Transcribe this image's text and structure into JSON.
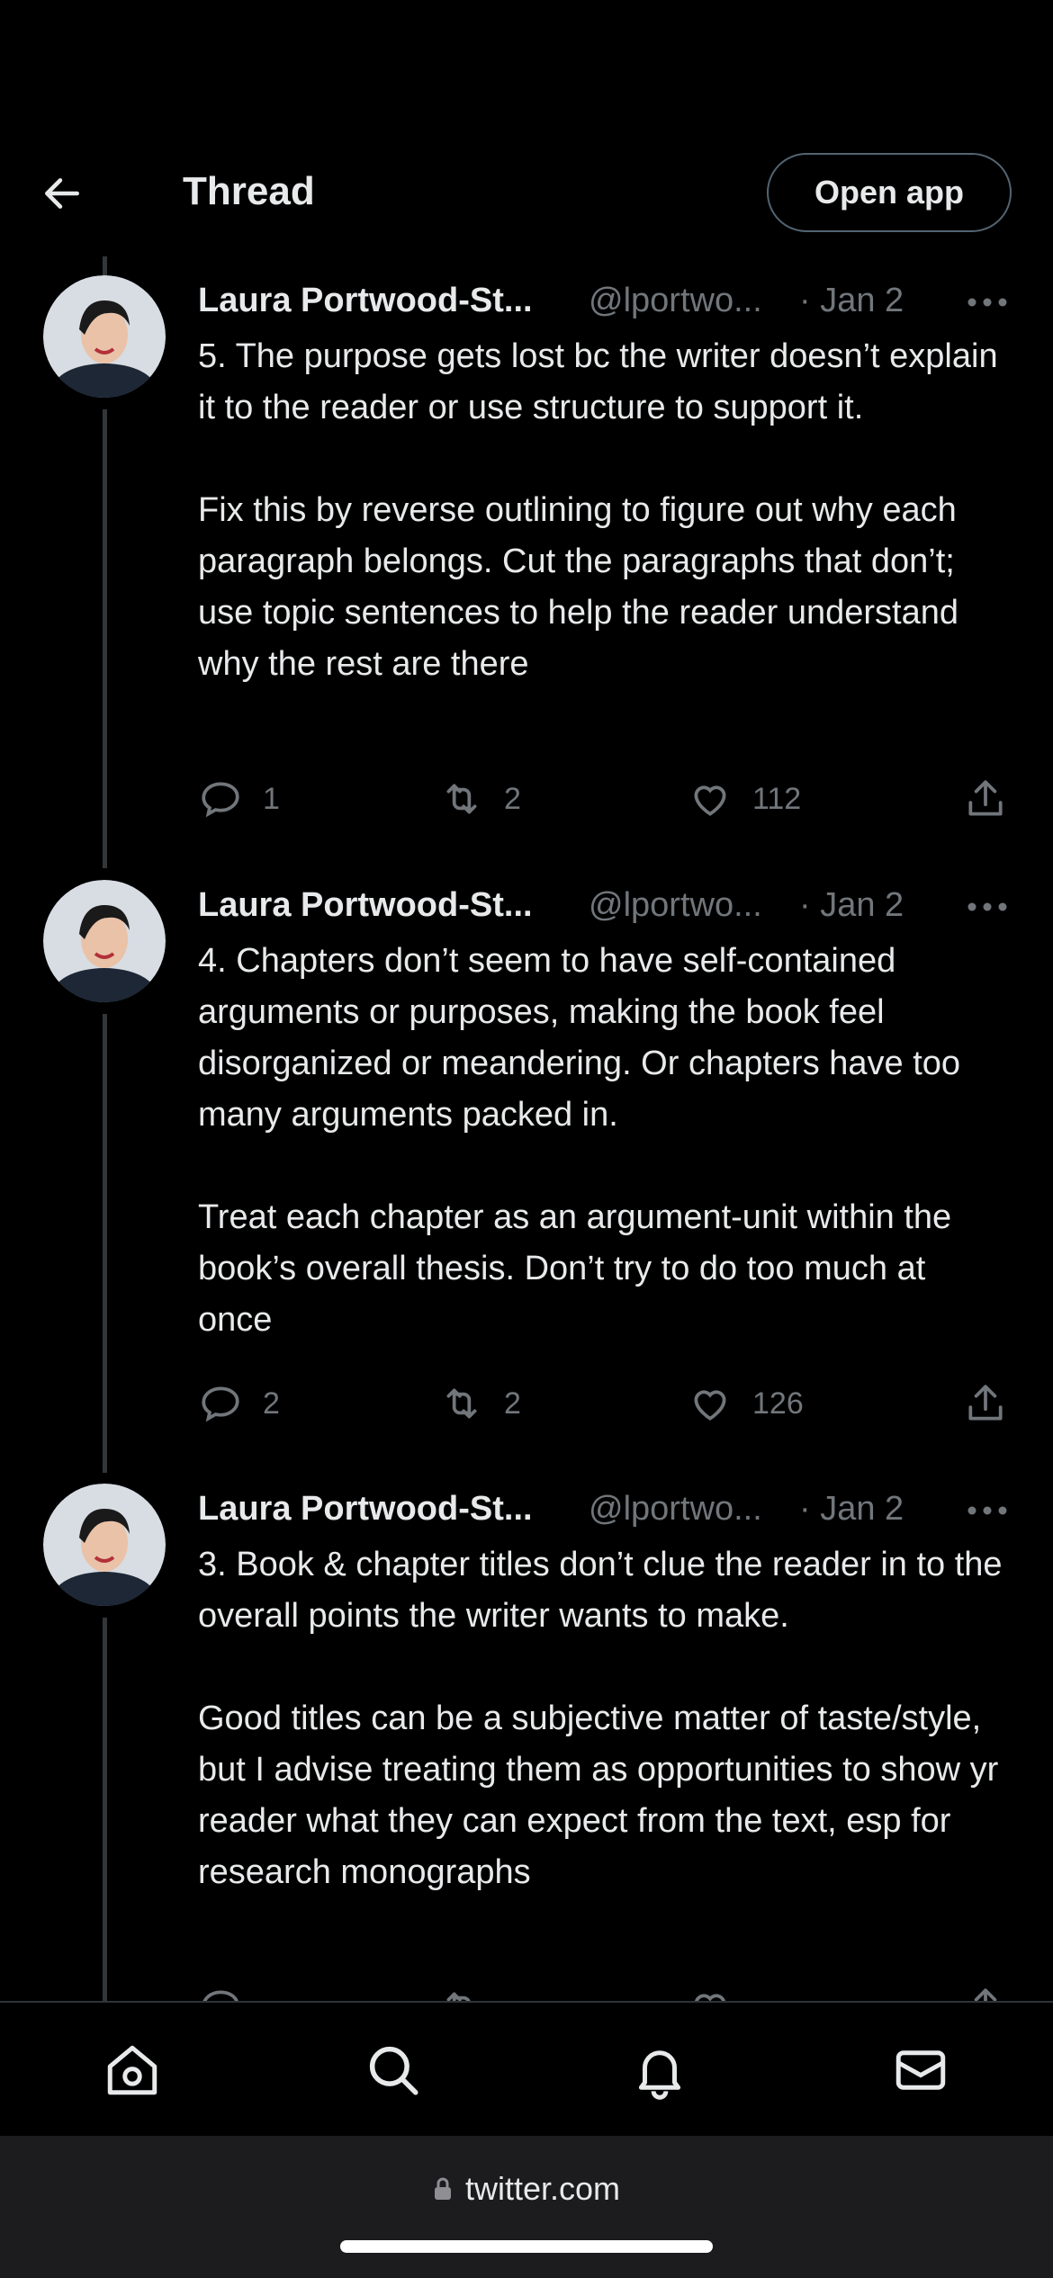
{
  "header": {
    "title": "Thread",
    "open_app_label": "Open app",
    "back_icon": "arrow-left-icon"
  },
  "tweets": [
    {
      "name": "Laura Portwood-St...",
      "handle": "@lportwo...",
      "date": "· Jan 2",
      "paragraphs": [
        "5. The purpose gets lost bc the writer doesn’t explain it to the reader or use structure to support it.",
        "Fix this by reverse outlining to figure out why each paragraph belongs. Cut the paragraphs that don’t; use topic sentences to help the reader understand why the rest are there"
      ],
      "replies": "1",
      "retweets": "2",
      "likes": "112"
    },
    {
      "name": "Laura Portwood-St...",
      "handle": "@lportwo...",
      "date": "· Jan 2",
      "paragraphs": [
        "4. Chapters don’t seem to have self-contained arguments or purposes, making the book feel disorganized or meandering. Or chapters have too many arguments packed in.",
        "Treat each chapter as an argument-unit within the book’s overall thesis. Don’t try to do too much at once"
      ],
      "replies": "2",
      "retweets": "2",
      "likes": "126"
    },
    {
      "name": "Laura Portwood-St...",
      "handle": "@lportwo...",
      "date": "· Jan 2",
      "paragraphs": [
        "3. Book & chapter titles don’t clue the reader in to the overall points the writer wants to make.",
        "Good titles can be a subjective matter of taste/style, but I advise treating them as opportunities to show yr reader what they can expect from the text, esp for research monographs"
      ]
    }
  ],
  "bottom_nav": [
    "home-icon",
    "search-icon",
    "bell-icon",
    "mail-icon"
  ],
  "browser": {
    "url": "twitter.com"
  },
  "colors": {
    "background": "#000000",
    "text": "#e7e9ea",
    "muted": "#71767b"
  }
}
